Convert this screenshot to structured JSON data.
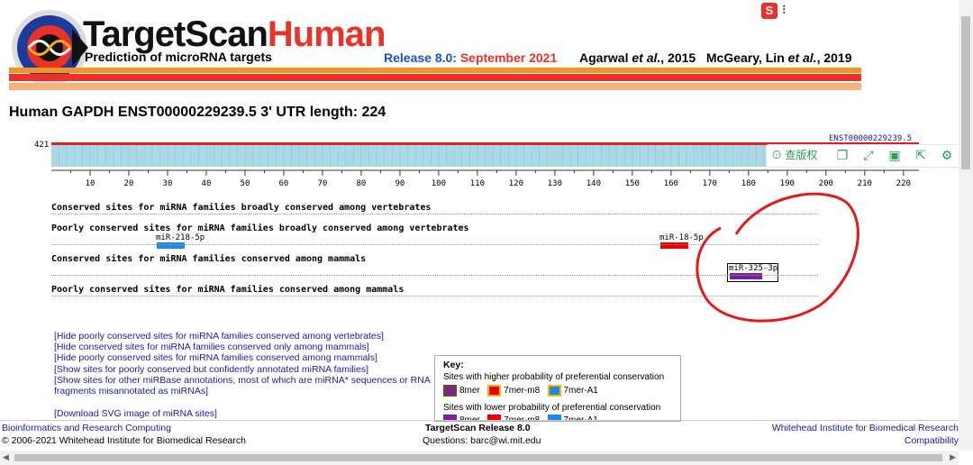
{
  "header": {
    "logo_part1": "TargetScan",
    "logo_part2": "Human",
    "subtitle": "Prediction of microRNA targets",
    "release_label": "Release 8.0:",
    "release_date": "September 2021",
    "citation1_name": "Agarwal",
    "citation1_etal": "et al.",
    "citation1_year": ", 2015",
    "citation2_name": "McGeary, Lin",
    "citation2_etal": "et al.",
    "citation2_year": ", 2019",
    "colors": {
      "brand_red": "#e8322a",
      "orange": "#f5a623",
      "blue_release": "#1a4fd6"
    }
  },
  "page_title": "Human GAPDH  ENST00000229239.5   3' UTR length: 224",
  "utr_plot": {
    "top_value": "421",
    "transcript_label": "ENST00000229239.5",
    "axis_ticks": [
      "10",
      "20",
      "30",
      "40",
      "50",
      "60",
      "70",
      "80",
      "90",
      "100",
      "110",
      "120",
      "130",
      "140",
      "150",
      "160",
      "170",
      "180",
      "190",
      "200",
      "210",
      "220"
    ],
    "utr_length": 224
  },
  "sections": {
    "conserved_vertebrates": "Conserved sites for miRNA families broadly conserved among vertebrates",
    "poorly_vertebrates": "Poorly conserved sites for miRNA families broadly conserved among vertebrates",
    "conserved_mammals": "Conserved sites for miRNA families conserved among mammals",
    "poorly_mammals": "Poorly conserved sites for miRNA families conserved among mammals"
  },
  "sites": [
    {
      "name": "miR-218-5p",
      "type": "7mer-A1",
      "color": "#1e88e5"
    },
    {
      "name": "miR-18-5p",
      "type": "7mer-m8",
      "color": "#ee0000"
    },
    {
      "name": "miR-325-3p",
      "type": "8mer",
      "color": "#7b1fa2"
    }
  ],
  "links": [
    "[Hide poorly conserved sites for miRNA families conserved among vertebrates]",
    "[Hide conserved sites for miRNA families conserved only among mammals]",
    "[Hide poorly conserved sites for miRNA families conserved among mammals]",
    "[Show sites for poorly conserved but confidently annotated miRNA families]",
    "[Show sites for other miRBase annotations, most of which are miRNA* sequences or RNA",
    "fragments misannotated as miRNAs]",
    "[Download SVG image of miRNA sites]"
  ],
  "key": {
    "title": "Key:",
    "higher": "Sites with higher probability of preferential conservation",
    "lower": "Sites with lower probability of preferential conservation",
    "items": [
      "8mer",
      "7mer-m8",
      "7mer-A1"
    ],
    "colors": {
      "8mer": "#7b1fa2",
      "7mer-m8": "#ee0000",
      "7mer-A1": "#1e88e5"
    }
  },
  "toolbar": {
    "copyright_label": "查版权"
  },
  "footer": {
    "left_link": "Bioinformatics and Research Computing",
    "left_text": "© 2006-2021 Whitehead Institute for Biomedical Research",
    "center_title": "TargetScan Release 8.0",
    "center_questions": "Questions: barc@wi.mit.edu",
    "right_link": "Whitehead Institute for Biomedical Research",
    "right_link2": "Compatibility"
  }
}
